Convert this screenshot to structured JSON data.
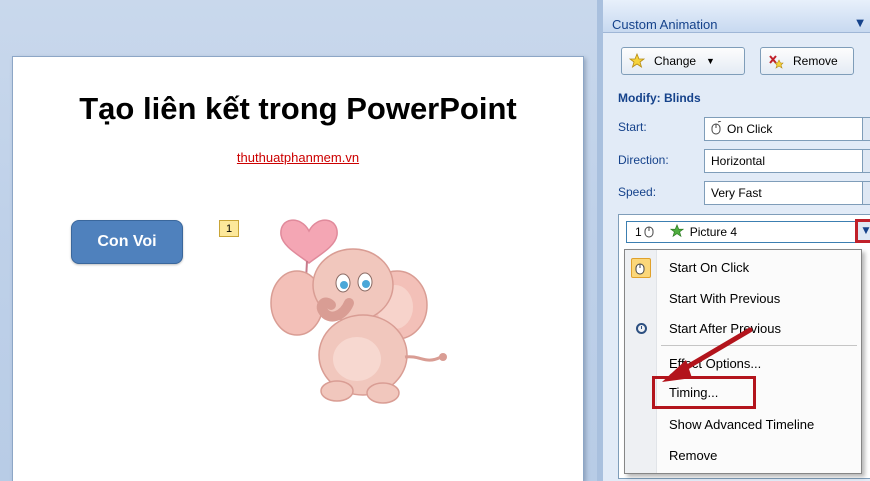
{
  "slide": {
    "title": "Tạo liên kết trong PowerPoint",
    "link_text": "thuthuatphanmem.vn",
    "button_label": "Con Voi",
    "animation_tag": "1"
  },
  "task_pane": {
    "title": "Custom Animation",
    "change_label": "Change",
    "remove_label": "Remove",
    "modify_label": "Modify: Blinds",
    "start_label": "Start:",
    "start_value": "On Click",
    "direction_label": "Direction:",
    "direction_value": "Horizontal",
    "speed_label": "Speed:",
    "speed_value": "Very Fast",
    "list_item": {
      "number": "1",
      "name": "Picture 4"
    }
  },
  "context_menu": {
    "items": [
      "Start On Click",
      "Start With Previous",
      "Start After Previous",
      "Effect Options...",
      "Timing...",
      "Show Advanced Timeline",
      "Remove"
    ]
  },
  "colors": {
    "accent_red": "#b3141c",
    "button_blue": "#4f81bd",
    "pane_text": "#15428b",
    "menu_highlight": "#fbd77a"
  },
  "icons": [
    "star-icon",
    "remove-effect-icon",
    "mouse-click-icon",
    "clock-icon",
    "dropdown-arrow-icon"
  ]
}
